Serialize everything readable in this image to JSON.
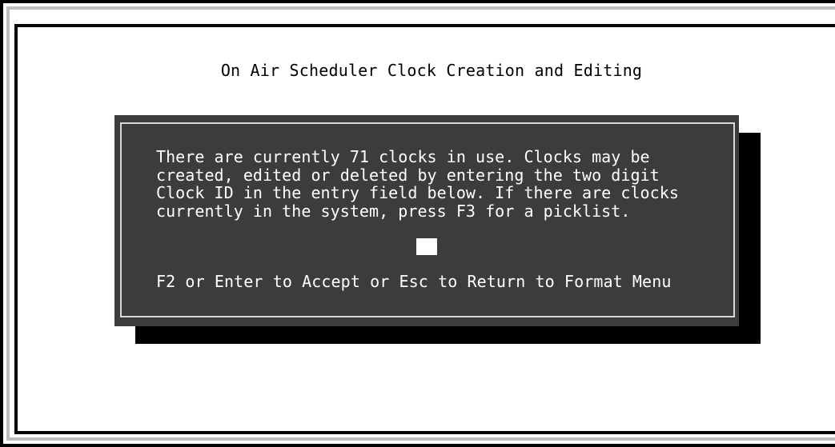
{
  "screen": {
    "title": "On Air Scheduler Clock Creation and Editing"
  },
  "dialog": {
    "message_lines": [
      "There are currently 71 clocks in use. Clocks may be",
      "created, edited or deleted by entering the two digit",
      "Clock ID in the entry field below. If there are clocks",
      "currently in the system, press F3 for a picklist."
    ],
    "entry_value": "",
    "hint": "F2 or Enter to Accept or Esc to Return to Format Menu"
  },
  "colors": {
    "background": "#ffffff",
    "dialog_background": "#3c3c3c",
    "dialog_text": "#ffffff",
    "shadow": "#000000"
  }
}
